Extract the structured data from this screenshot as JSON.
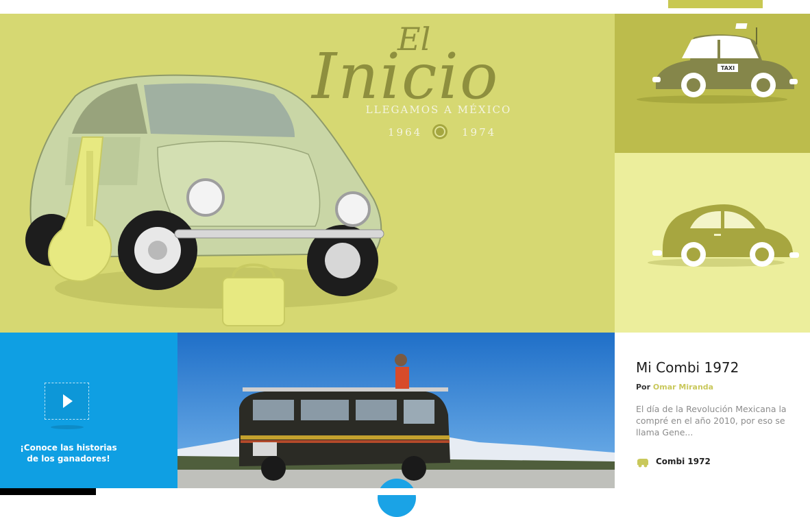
{
  "hero": {
    "script_small": "El",
    "script_large": "Inicio",
    "subtitle": "LLEGAMOS A MÉXICO",
    "year_start": "1964",
    "year_end": "1974"
  },
  "right_column": {
    "taxi_label": "TAXI"
  },
  "promo": {
    "text": "¡Conoce las historias de los ganadores!",
    "icon": "play-icon"
  },
  "story": {
    "title": "Mi Combi 1972",
    "author_prefix": "Por",
    "author_name": "Omar Miranda",
    "excerpt": "El día de la Revolución Mexicana la compré en el año 2010, por eso se llama Gene...",
    "tag_icon": "van-icon",
    "tag": "Combi 1972"
  },
  "colors": {
    "hero_bg": "#d6d872",
    "taxi_tile": "#bcbc4c",
    "beetle_tile": "#ecee9c",
    "promo_blue": "#0f9fe3",
    "accent_olive": "#c9c85b"
  }
}
